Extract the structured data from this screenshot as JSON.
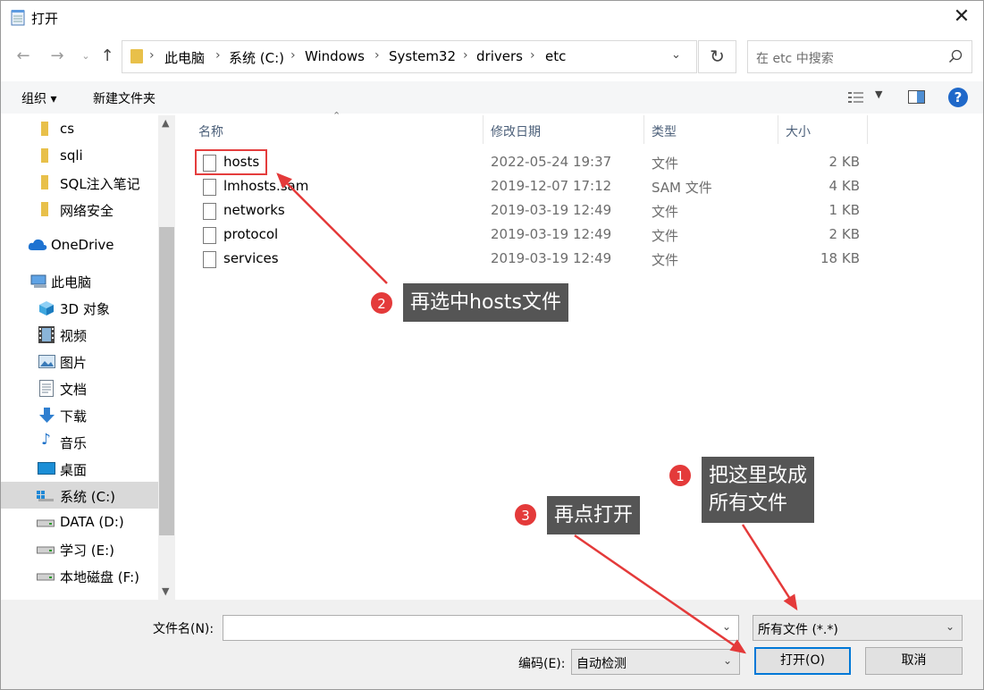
{
  "window": {
    "title": "打开"
  },
  "address": {
    "crumbs": [
      "此电脑",
      "系统 (C:)",
      "Windows",
      "System32",
      "drivers",
      "etc"
    ],
    "search_placeholder": "在 etc 中搜索"
  },
  "toolbar": {
    "organize": "组织",
    "new_folder": "新建文件夹"
  },
  "sidebar": {
    "items": [
      {
        "label": "cs",
        "icon": "folder-icon"
      },
      {
        "label": "sqli",
        "icon": "folder-icon"
      },
      {
        "label": "SQL注入笔记",
        "icon": "folder-icon"
      },
      {
        "label": "网络安全",
        "icon": "folder-icon"
      },
      {
        "label": "OneDrive",
        "icon": "cloud-icon"
      },
      {
        "label": "此电脑",
        "icon": "computer-icon"
      },
      {
        "label": "3D 对象",
        "icon": "cube-icon"
      },
      {
        "label": "视频",
        "icon": "video-icon"
      },
      {
        "label": "图片",
        "icon": "picture-icon"
      },
      {
        "label": "文档",
        "icon": "document-icon"
      },
      {
        "label": "下载",
        "icon": "download-icon"
      },
      {
        "label": "音乐",
        "icon": "music-icon"
      },
      {
        "label": "桌面",
        "icon": "desktop-icon"
      },
      {
        "label": "系统 (C:)",
        "icon": "system-drive-icon"
      },
      {
        "label": "DATA (D:)",
        "icon": "drive-icon"
      },
      {
        "label": "学习 (E:)",
        "icon": "drive-icon"
      },
      {
        "label": "本地磁盘 (F:)",
        "icon": "drive-icon"
      }
    ]
  },
  "file_list": {
    "columns": [
      "名称",
      "修改日期",
      "类型",
      "大小"
    ],
    "rows": [
      {
        "name": "hosts",
        "date": "2022-05-24 19:37",
        "type": "文件",
        "size": "2 KB"
      },
      {
        "name": "lmhosts.sam",
        "date": "2019-12-07 17:12",
        "type": "SAM 文件",
        "size": "4 KB"
      },
      {
        "name": "networks",
        "date": "2019-03-19 12:49",
        "type": "文件",
        "size": "1 KB"
      },
      {
        "name": "protocol",
        "date": "2019-03-19 12:49",
        "type": "文件",
        "size": "2 KB"
      },
      {
        "name": "services",
        "date": "2019-03-19 12:49",
        "type": "文件",
        "size": "18 KB"
      }
    ]
  },
  "bottom": {
    "filename_label": "文件名(N):",
    "filename_value": "",
    "filetype_value": "所有文件  (*.*)",
    "encoding_label": "编码(E):",
    "encoding_value": "自动检测",
    "open_label": "打开(O)",
    "cancel_label": "取消"
  },
  "annotations": [
    {
      "num": "1",
      "text_line1": "把这里改成",
      "text_line2": "所有文件"
    },
    {
      "num": "2",
      "text": "再选中hosts文件"
    },
    {
      "num": "3",
      "text": "再点打开"
    }
  ],
  "colors": {
    "annotation_red": "#e43a3a",
    "callout_bg": "#555555",
    "accent_blue": "#0078d7"
  }
}
